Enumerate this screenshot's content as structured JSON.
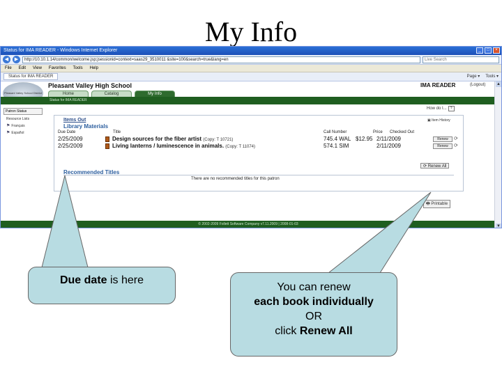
{
  "slide": {
    "title": "My Info"
  },
  "browser": {
    "title": "Status for IMA READER - Windows Internet Explorer",
    "address": "http://10.10.1.14/common/welcome.jsp;jsessionid=context=saas29_3510011 &site=100&search=true&lang=en",
    "search_placeholder": "Live Search",
    "menu": [
      "File",
      "Edit",
      "View",
      "Favorites",
      "Tools",
      "Help"
    ],
    "tab": "Status for IMA READER",
    "tools": [
      "Page ▾",
      "Tools ▾"
    ]
  },
  "site": {
    "seal_text": "Pleasant Valley School District",
    "school": "Pleasant Valley High School",
    "user": "IMA READER",
    "logout": "Logout",
    "tabs": [
      "Home",
      "Catalog",
      "My Info"
    ],
    "breadcrumb": "Status for IMA READER",
    "left_nav": {
      "heading": "Patron Status",
      "resource_lists": "Resource Lists",
      "lang1": "Français",
      "lang2": "Español"
    },
    "how_do_i": "How do I...",
    "items_out": "Items Out",
    "item_history": "Item History",
    "library_materials": "Library Materials",
    "columns": {
      "due_date": "Due Date",
      "title": "Title",
      "call_number": "Call Number",
      "price": "Price",
      "checked_out": "Checked Out"
    },
    "items": [
      {
        "due": "2/25/2009",
        "title": "Design sources for the fiber artist",
        "copy": "(Copy: T 10721)",
        "call": "745.4 WAL",
        "price": "$12.95",
        "checked": "2/11/2009",
        "renew": "Renew"
      },
      {
        "due": "2/25/2009",
        "title": "Living lanterns / luminescence in animals.",
        "copy": "(Copy: T 11074)",
        "call": "574.1 SIM",
        "price": "",
        "checked": "2/11/2009",
        "renew": "Renew"
      }
    ],
    "renew_all": "Renew All",
    "recommended_title": "Recommended Titles",
    "no_recommended": "There are no recommended titles for this patron",
    "printable": "Printable",
    "footer": "© 2002-2009 Follett Software Company    v7.11.2009 | 2008-01-03"
  },
  "callouts": {
    "left": {
      "bold": "Due date",
      "rest": " is here"
    },
    "right": {
      "line1": "You can renew",
      "line2": "each book individually",
      "line3": "OR",
      "line4_prefix": "click ",
      "line4_bold": "Renew All"
    }
  },
  "colors": {
    "callout_fill": "#b8dce2",
    "site_green": "#1f5e20",
    "ie_blue": "#1e50b8"
  }
}
